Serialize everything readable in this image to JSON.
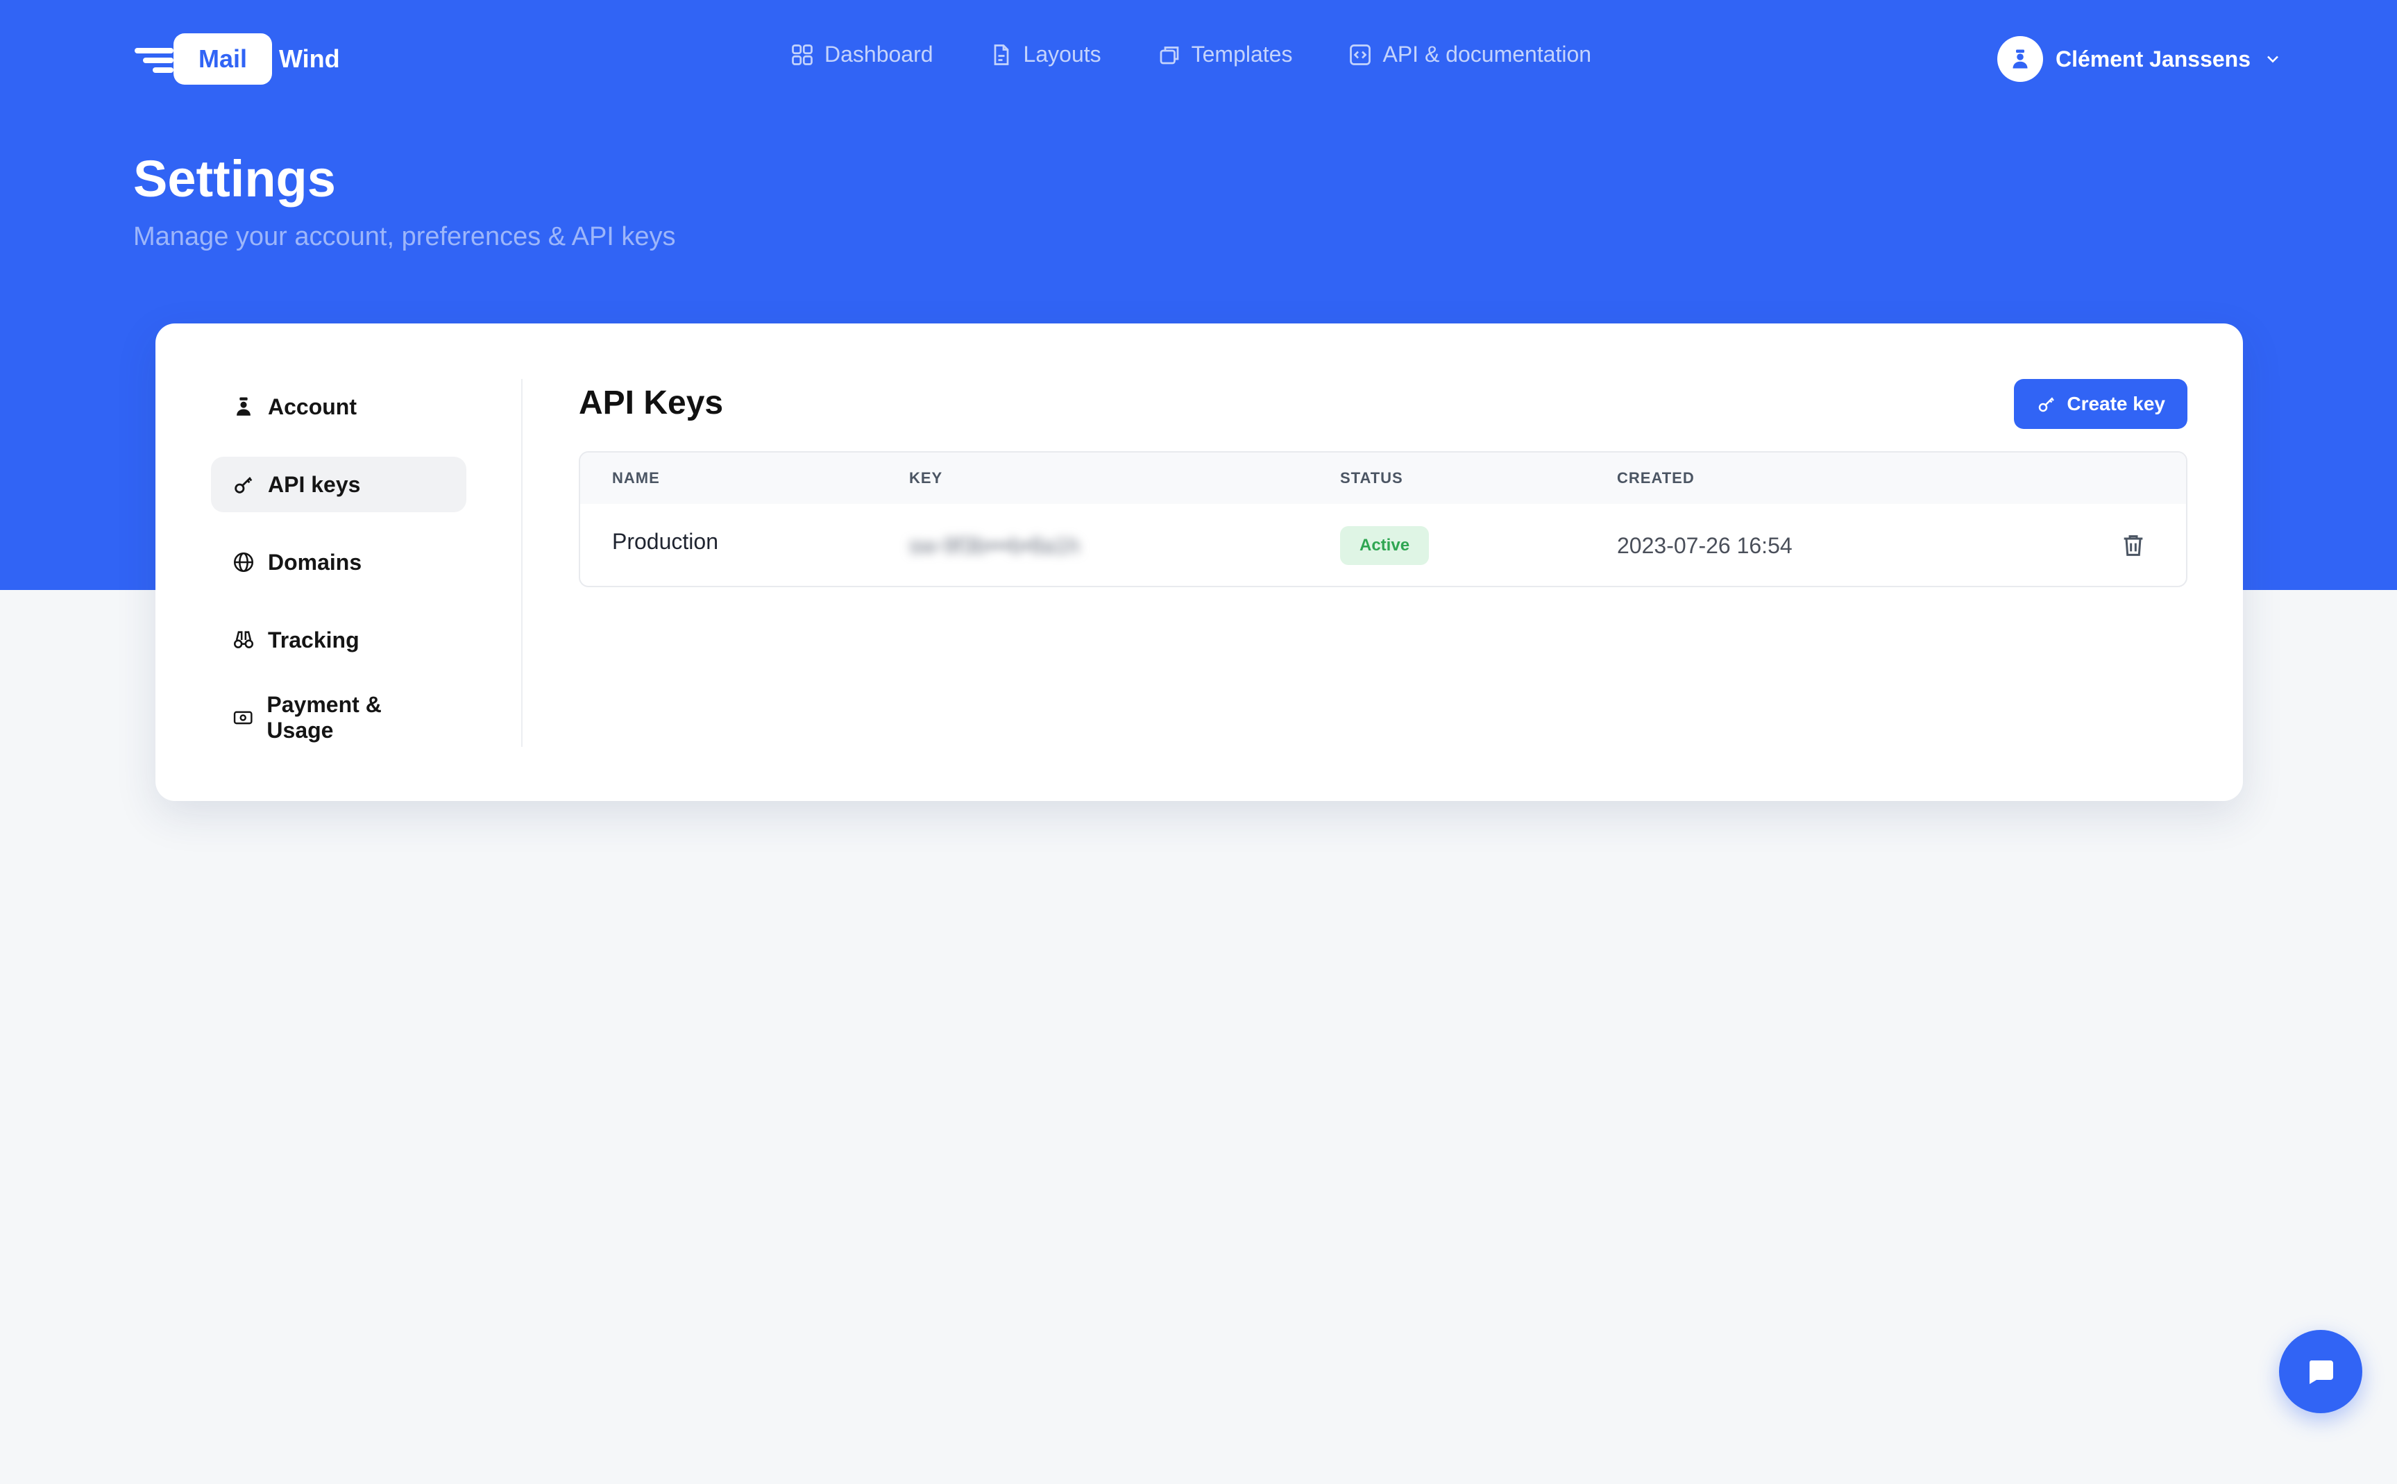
{
  "brand": {
    "logo_primary": "Mail",
    "logo_secondary": "Wind",
    "accent": "#3164f5"
  },
  "nav": {
    "items": [
      {
        "label": "Dashboard",
        "icon": "grid-icon"
      },
      {
        "label": "Layouts",
        "icon": "document-icon"
      },
      {
        "label": "Templates",
        "icon": "templates-icon"
      },
      {
        "label": "API & documentation",
        "icon": "code-icon"
      }
    ]
  },
  "user": {
    "name": "Clément Janssens",
    "avatar_icon": "user-icon"
  },
  "header": {
    "title": "Settings",
    "subtitle": "Manage your account, preferences & API keys"
  },
  "sidebar": {
    "items": [
      {
        "label": "Account",
        "icon": "user-icon",
        "active": false
      },
      {
        "label": "API keys",
        "icon": "key-icon",
        "active": true
      },
      {
        "label": "Domains",
        "icon": "globe-icon",
        "active": false
      },
      {
        "label": "Tracking",
        "icon": "binoculars-icon",
        "active": false
      },
      {
        "label": "Payment & Usage",
        "icon": "money-icon",
        "active": false
      }
    ]
  },
  "api_keys": {
    "title": "API Keys",
    "create_label": "Create key",
    "columns": [
      "NAME",
      "KEY",
      "STATUS",
      "CREATED"
    ],
    "rows": [
      {
        "name": "Production",
        "key": "sw-9f3b•••b•8a1h",
        "status": "Active",
        "created": "2023-07-26 16:54"
      }
    ]
  },
  "colors": {
    "hero_bg": "#3164f5",
    "status_active_bg": "#dff5e5",
    "status_active_text": "#2fa652"
  }
}
